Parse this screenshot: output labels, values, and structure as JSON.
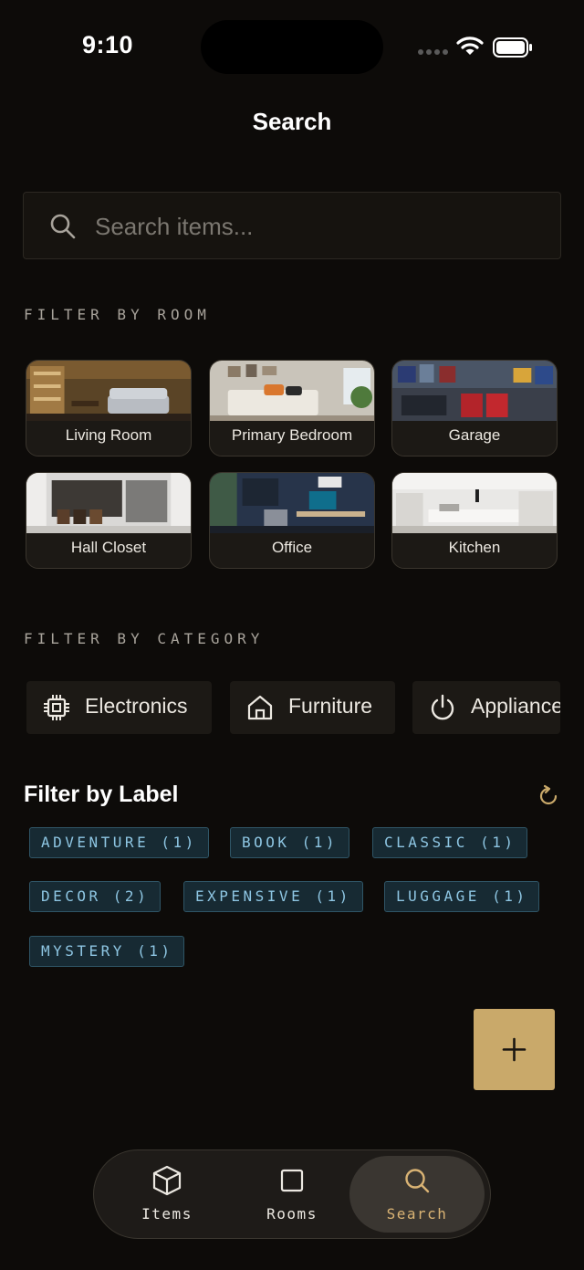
{
  "status_bar": {
    "time": "9:10"
  },
  "header": {
    "title": "Search"
  },
  "search": {
    "placeholder": "Search items..."
  },
  "room_filter": {
    "heading": "FILTER BY ROOM",
    "rooms": [
      {
        "label": "Living Room"
      },
      {
        "label": "Primary Bedroom"
      },
      {
        "label": "Garage"
      },
      {
        "label": "Hall Closet"
      },
      {
        "label": "Office"
      },
      {
        "label": "Kitchen"
      }
    ]
  },
  "category_filter": {
    "heading": "FILTER BY CATEGORY",
    "categories": [
      {
        "label": "Electronics",
        "icon": "chip-icon"
      },
      {
        "label": "Furniture",
        "icon": "home-icon"
      },
      {
        "label": "Appliance",
        "icon": "power-icon"
      }
    ]
  },
  "label_filter": {
    "heading": "Filter by Label",
    "labels": [
      {
        "text": "ADVENTURE (1)"
      },
      {
        "text": "BOOK (1)"
      },
      {
        "text": "CLASSIC (1)"
      },
      {
        "text": "DECOR (2)"
      },
      {
        "text": "EXPENSIVE (1)"
      },
      {
        "text": "LUGGAGE (1)"
      },
      {
        "text": "MYSTERY (1)"
      }
    ]
  },
  "fab": {
    "icon": "plus-icon"
  },
  "tab_bar": {
    "tabs": [
      {
        "label": "Items",
        "icon": "box-icon"
      },
      {
        "label": "Rooms",
        "icon": "square-icon"
      },
      {
        "label": "Search",
        "icon": "search-icon",
        "active": true
      }
    ]
  },
  "colors": {
    "background": "#0d0b09",
    "accent": "#c9a96a",
    "tag_text": "#8ec6e3",
    "tag_background": "#172a33"
  }
}
